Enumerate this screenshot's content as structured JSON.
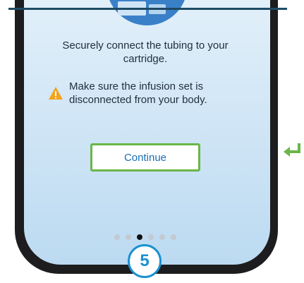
{
  "screen": {
    "instruction_text": "Securely connect the tubing to your cartridge.",
    "warning_text": "Make sure the infusion set is disconnected from your body.",
    "continue_label": "Continue"
  },
  "pagination": {
    "total": 6,
    "active_index": 2
  },
  "step": {
    "number": "5"
  },
  "icons": {
    "warning": "warning-triangle-icon",
    "return": "return-arrow-icon"
  },
  "colors": {
    "accent_green": "#6ab648",
    "accent_blue": "#1a91d1",
    "button_text": "#1a6fb5",
    "warning_orange": "#f5a21b",
    "frame": "#1d1d1f"
  }
}
